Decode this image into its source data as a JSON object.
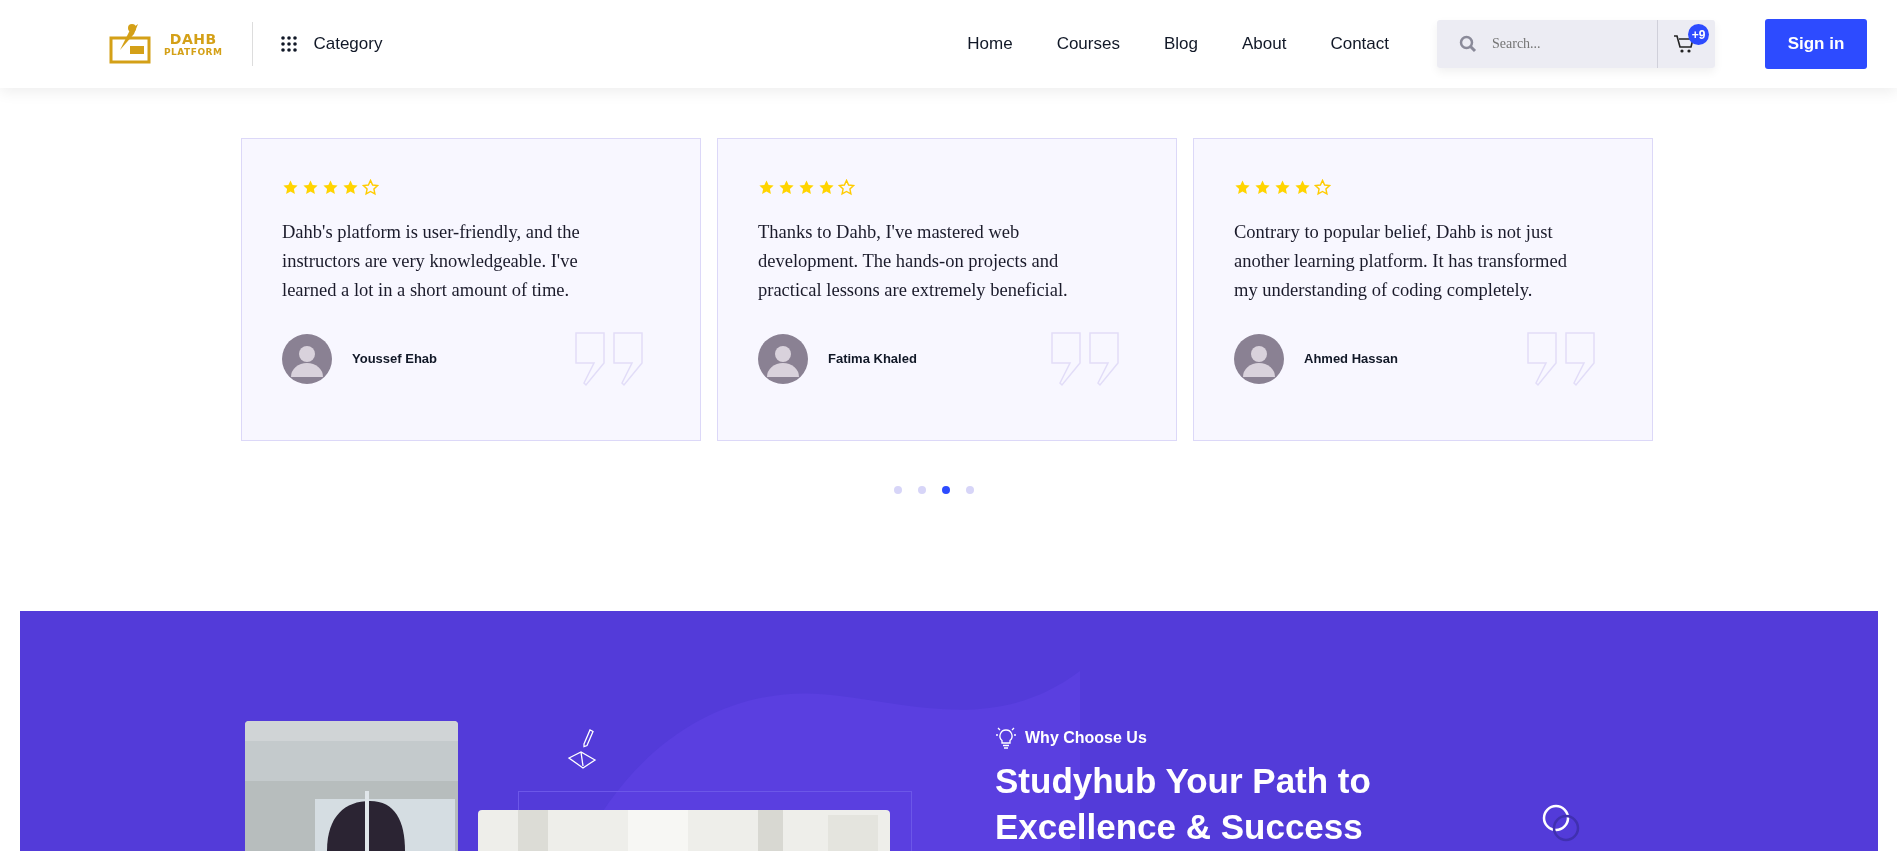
{
  "header": {
    "logo": {
      "line_1": "DAHB",
      "line_2": "PLATFORM"
    },
    "category": "Category",
    "nav": [
      {
        "label": "Home"
      },
      {
        "label": "Courses"
      },
      {
        "label": "Blog"
      },
      {
        "label": "About"
      },
      {
        "label": "Contact"
      }
    ],
    "search": {
      "placeholder": "Search..."
    },
    "cart_count": "+9",
    "sign_in": "Sign in"
  },
  "testimonials": [
    {
      "stars": 4,
      "text": "Dahb's platform is user-friendly, and the instructors are very knowledgeable. I've learned a lot in a short amount of time.",
      "name": "Youssef Ehab"
    },
    {
      "stars": 4,
      "text": "Thanks to Dahb, I've mastered web development. The hands-on projects and practical lessons are extremely beneficial.",
      "name": "Fatima Khaled"
    },
    {
      "stars": 4,
      "text": "Contrary to popular belief, Dahb is not just another learning platform. It has transformed my understanding of coding completely.",
      "name": "Ahmed Hassan"
    }
  ],
  "carousel_dots": [
    {
      "selected": false
    },
    {
      "selected": false
    },
    {
      "selected": true
    },
    {
      "selected": false
    }
  ],
  "why_section": {
    "eyebrow": "Why Choose Us",
    "heading": "Studyhub Your Path to Excellence & Success"
  }
}
